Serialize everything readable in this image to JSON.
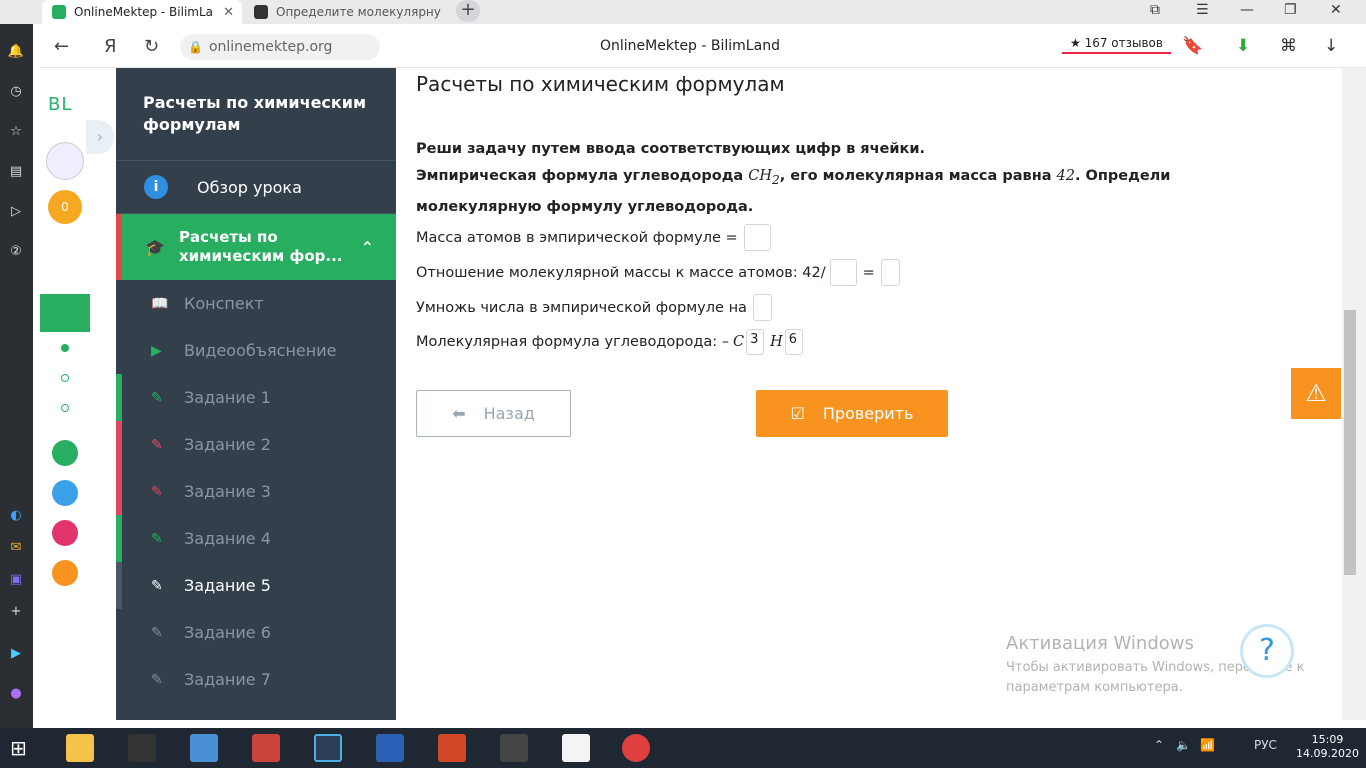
{
  "browser": {
    "tabs": [
      {
        "label": "OnlineMektep - BilimLa",
        "favicon_color": "#27ae60"
      },
      {
        "label": "Определите молекулярну",
        "favicon_color": "#333333"
      }
    ],
    "url": "onlinemektep.org",
    "page_title": "OnlineMektep - BilimLand",
    "reviews": "★ 167 отзывов",
    "yandex_letter": "Я"
  },
  "rail": {
    "logo": "BL",
    "coins": "0"
  },
  "lesson_nav": {
    "title": "Расчеты по химическим формулам",
    "overview": "Обзор урока",
    "active_section": "Расчеты по химическим фор...",
    "items": [
      {
        "label": "Конспект",
        "icon": "book-icon"
      },
      {
        "label": "Видеообъяснение",
        "icon": "play-icon"
      },
      {
        "label": "Задание 1",
        "icon": "edit-icon"
      },
      {
        "label": "Задание 2",
        "icon": "edit-icon"
      },
      {
        "label": "Задание 3",
        "icon": "edit-icon"
      },
      {
        "label": "Задание 4",
        "icon": "edit-icon"
      },
      {
        "label": "Задание 5",
        "icon": "edit-icon"
      },
      {
        "label": "Задание 6",
        "icon": "edit-icon"
      },
      {
        "label": "Задание 7",
        "icon": "edit-icon"
      }
    ]
  },
  "content": {
    "heading": "Расчеты по химическим формулам",
    "instruction": "Реши задачу путем ввода соответствующих цифр в ячейки.",
    "problem_part1": "Эмпирическая формула углеводорода ",
    "formula_c": "CH",
    "formula_sub": "2",
    "problem_part2": ", его молекулярная масса равна ",
    "mass_value": "42",
    "problem_part3": ". Определи молекулярную формулу углеводорода.",
    "line1_label": "Масса атомов в эмпирической формуле = ",
    "line2_label": "Отношение молекулярной массы к массе атомов: 42/",
    "line2_eq": "=",
    "line3_label": "Умножь числа в эмпирической формуле на",
    "line4_label": "Молекулярная формула углеводорода: – ",
    "line4_c": "C",
    "line4_c_value": "3",
    "line4_h": "H",
    "line4_h_value": "6",
    "back_label": "Назад",
    "check_label": "Проверить"
  },
  "activation": {
    "title": "Активация Windows",
    "line1": "Чтобы активировать Windows, перейдите к",
    "line2": "параметрам компьютера."
  },
  "taskbar": {
    "lang": "РУС",
    "time": "15:09",
    "date": "14.09.2020"
  }
}
